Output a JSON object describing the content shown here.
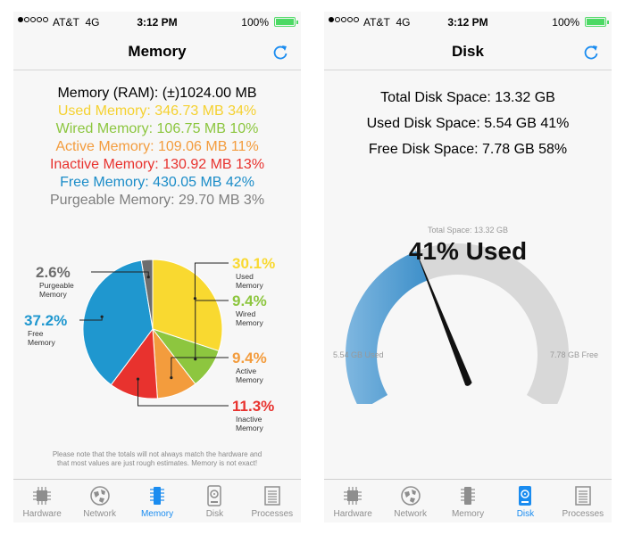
{
  "status": {
    "carrier": "AT&T",
    "network": "4G",
    "time": "3:12 PM",
    "battery": "100%"
  },
  "memory_screen": {
    "title": "Memory",
    "lines": [
      {
        "text": "Memory (RAM): (±)1024.00 MB",
        "color": "#000000"
      },
      {
        "text": "Used Memory: 346.73 MB 34%",
        "color": "#f5d130"
      },
      {
        "text": "Wired Memory: 106.75 MB 10%",
        "color": "#8cc63f"
      },
      {
        "text": "Active Memory: 109.06 MB 11%",
        "color": "#f39c3d"
      },
      {
        "text": "Inactive Memory: 130.92 MB 13%",
        "color": "#e8322e"
      },
      {
        "text": "Free Memory: 430.05 MB 42%",
        "color": "#1a8cc8"
      },
      {
        "text": "Purgeable Memory: 29.70 MB 3%",
        "color": "#7f7f7f"
      }
    ],
    "chart_data": {
      "type": "pie",
      "slices": [
        {
          "label": "Used Memory",
          "value": 30.1,
          "value_text": "30.1%",
          "color": "#f9d930"
        },
        {
          "label": "Wired Memory",
          "value": 9.4,
          "value_text": "9.4%",
          "color": "#8dc63f"
        },
        {
          "label": "Active Memory",
          "value": 9.4,
          "value_text": "9.4%",
          "color": "#f39c3d"
        },
        {
          "label": "Inactive Memory",
          "value": 11.3,
          "value_text": "11.3%",
          "color": "#e8322e"
        },
        {
          "label": "Free Memory",
          "value": 37.2,
          "value_text": "37.2%",
          "color": "#1f97cf"
        },
        {
          "label": "Purgeable Memory",
          "value": 2.6,
          "value_text": "2.6%",
          "color": "#6d6d6d"
        }
      ]
    },
    "note_line1": "Please note that the totals will not always match the hardware and",
    "note_line2": "that most values are just rough estimates.  Memory is not exact!"
  },
  "disk_screen": {
    "title": "Disk",
    "lines": [
      {
        "text": "Total Disk Space: 13.32 GB"
      },
      {
        "text": "Used Disk Space: 5.54 GB 41%"
      },
      {
        "text": "Free Disk Space: 7.78 GB 58%"
      }
    ],
    "gauge": {
      "total_label": "Total Space: 13.32 GB",
      "used_percent": 41,
      "big_label": "41% Used",
      "used_label": "5.54 GB Used",
      "free_label": "7.78 GB Free",
      "used_color": "#3d8fc9",
      "free_color": "#d8d8d8"
    }
  },
  "tabs": [
    "Hardware",
    "Network",
    "Memory",
    "Disk",
    "Processes"
  ],
  "colors": {
    "accent": "#1a8cf0",
    "inactive_tab": "#8e8e8e"
  }
}
